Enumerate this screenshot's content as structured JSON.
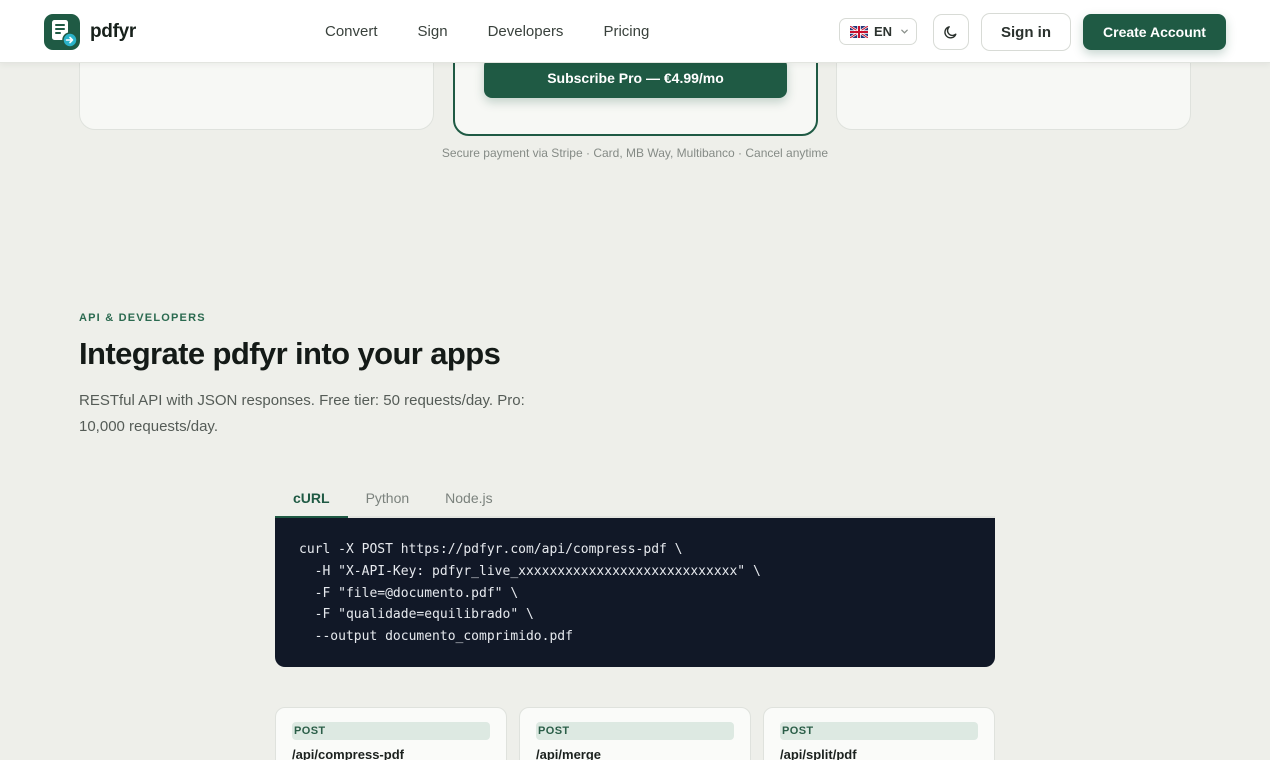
{
  "brand": {
    "name": "pdfyr"
  },
  "nav": {
    "items": [
      "Convert",
      "Sign",
      "Developers",
      "Pricing"
    ]
  },
  "header": {
    "language": "EN",
    "signin_label": "Sign in",
    "create_label": "Create Account"
  },
  "pricing": {
    "subscribe_label": "Subscribe Pro — €4.99/mo",
    "secure_note": "Secure payment via Stripe · Card, MB Way, Multibanco · Cancel anytime"
  },
  "api": {
    "eyebrow": "API & DEVELOPERS",
    "title": "Integrate pdfyr into your apps",
    "description": "RESTful API with JSON responses. Free tier: 50 requests/day. Pro: 10,000 requests/day.",
    "tabs": [
      "cURL",
      "Python",
      "Node.js"
    ],
    "active_tab": "cURL",
    "code": "curl -X POST https://pdfyr.com/api/compress-pdf \\\n  -H \"X-API-Key: pdfyr_live_xxxxxxxxxxxxxxxxxxxxxxxxxxxx\" \\\n  -F \"file=@documento.pdf\" \\\n  -F \"qualidade=equilibrado\" \\\n  --output documento_comprimido.pdf",
    "endpoints": [
      {
        "method": "POST",
        "path": "/api/compress-pdf"
      },
      {
        "method": "POST",
        "path": "/api/merge"
      },
      {
        "method": "POST",
        "path": "/api/split/pdf"
      }
    ]
  },
  "colors": {
    "brand": "#1f5a44",
    "background": "#eeefea",
    "code_bg": "#111827"
  }
}
